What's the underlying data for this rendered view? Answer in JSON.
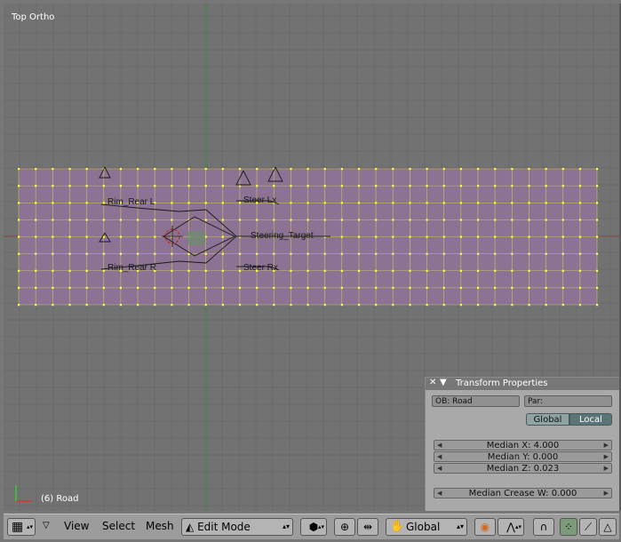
{
  "viewport": {
    "view_name": "Top Ortho",
    "object_status": "(6) Road",
    "grid_color": "#6a6a6a",
    "background_color": "#727272",
    "mesh_face_color": "#8c7393",
    "mesh_vertex_color": "#ffff3a",
    "bone_labels": [
      "Rim_Rear L",
      "Rim_Rear R",
      "Steer Lx",
      "Steer Rx",
      "Steering_Target"
    ]
  },
  "transform_panel": {
    "title": "Transform Properties",
    "ob_field": "OB: Road",
    "par_field": "Par:",
    "global_label": "Global",
    "local_label": "Local",
    "median_x": "Median X: 4.000",
    "median_y": "Median Y: 0.000",
    "median_z": "Median Z: 0.023",
    "median_crease": "Median Crease W: 0.000"
  },
  "header": {
    "menus": [
      "View",
      "Select",
      "Mesh"
    ],
    "mode": "Edit Mode",
    "orientation": "Global",
    "icons": {
      "editor_type": "grid-icon",
      "menu_collapse": "triangle-down-icon",
      "draw_type": "cube-icon",
      "pivot": "crosshair-icon",
      "manipulator": "transform-manip-icon",
      "orientation": "hand-icon",
      "proportional_edit": "proportional-circle-icon",
      "falloff": "falloff-curve-icon",
      "snap": "magnet-icon",
      "select_vertex": "vertex-select-icon",
      "select_edge": "edge-select-icon",
      "select_face": "face-select-icon"
    }
  }
}
